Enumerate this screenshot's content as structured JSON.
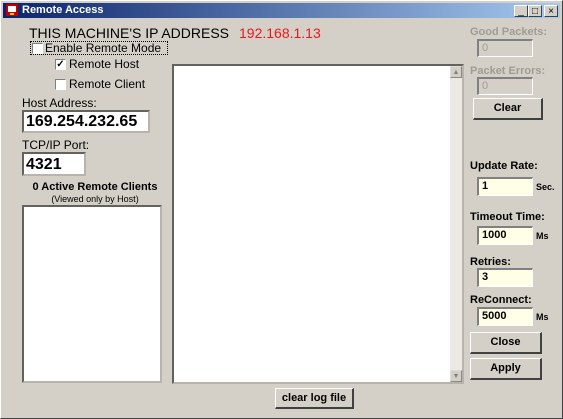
{
  "window": {
    "title": "Remote Access",
    "controls": {
      "minimize": "_",
      "maximize": "□",
      "close": "×"
    }
  },
  "ip": {
    "label": "THIS MACHINE'S IP ADDRESS",
    "value": "192.168.1.13"
  },
  "mode": {
    "enable_remote_label": "Enable Remote Mode",
    "enable_remote_checked": false,
    "remote_host_label": "Remote Host",
    "remote_host_checked": true,
    "remote_client_label": "Remote Client",
    "remote_client_checked": false
  },
  "host_address": {
    "label": "Host Address:",
    "value": "169.254.232.65"
  },
  "port": {
    "label": "TCP/IP Port:",
    "value": "4321"
  },
  "clients": {
    "title": "0 Active Remote Clients",
    "subtitle": "(Viewed only by Host)"
  },
  "log": {
    "clear_button": "clear log file",
    "scroll_up": "▲",
    "scroll_down": "▼"
  },
  "stats": {
    "good_packets_label": "Good Packets:",
    "good_packets_value": "0",
    "packet_errors_label": "Packet Errors:",
    "packet_errors_value": "0",
    "clear_button": "Clear"
  },
  "settings": {
    "update_rate_label": "Update Rate:",
    "update_rate_value": "1",
    "update_rate_unit": "Sec.",
    "timeout_label": "Timeout Time:",
    "timeout_value": "1000",
    "timeout_unit": "Ms",
    "retries_label": "Retries:",
    "retries_value": "3",
    "reconnect_label": "ReConnect:",
    "reconnect_value": "5000",
    "reconnect_unit": "Ms"
  },
  "buttons": {
    "close": "Close",
    "apply": "Apply"
  },
  "colors": {
    "ip_value": "#e8181c",
    "titlebar_start": "#0a246a",
    "titlebar_end": "#a6caf0",
    "field_bg": "#ffffe8"
  }
}
